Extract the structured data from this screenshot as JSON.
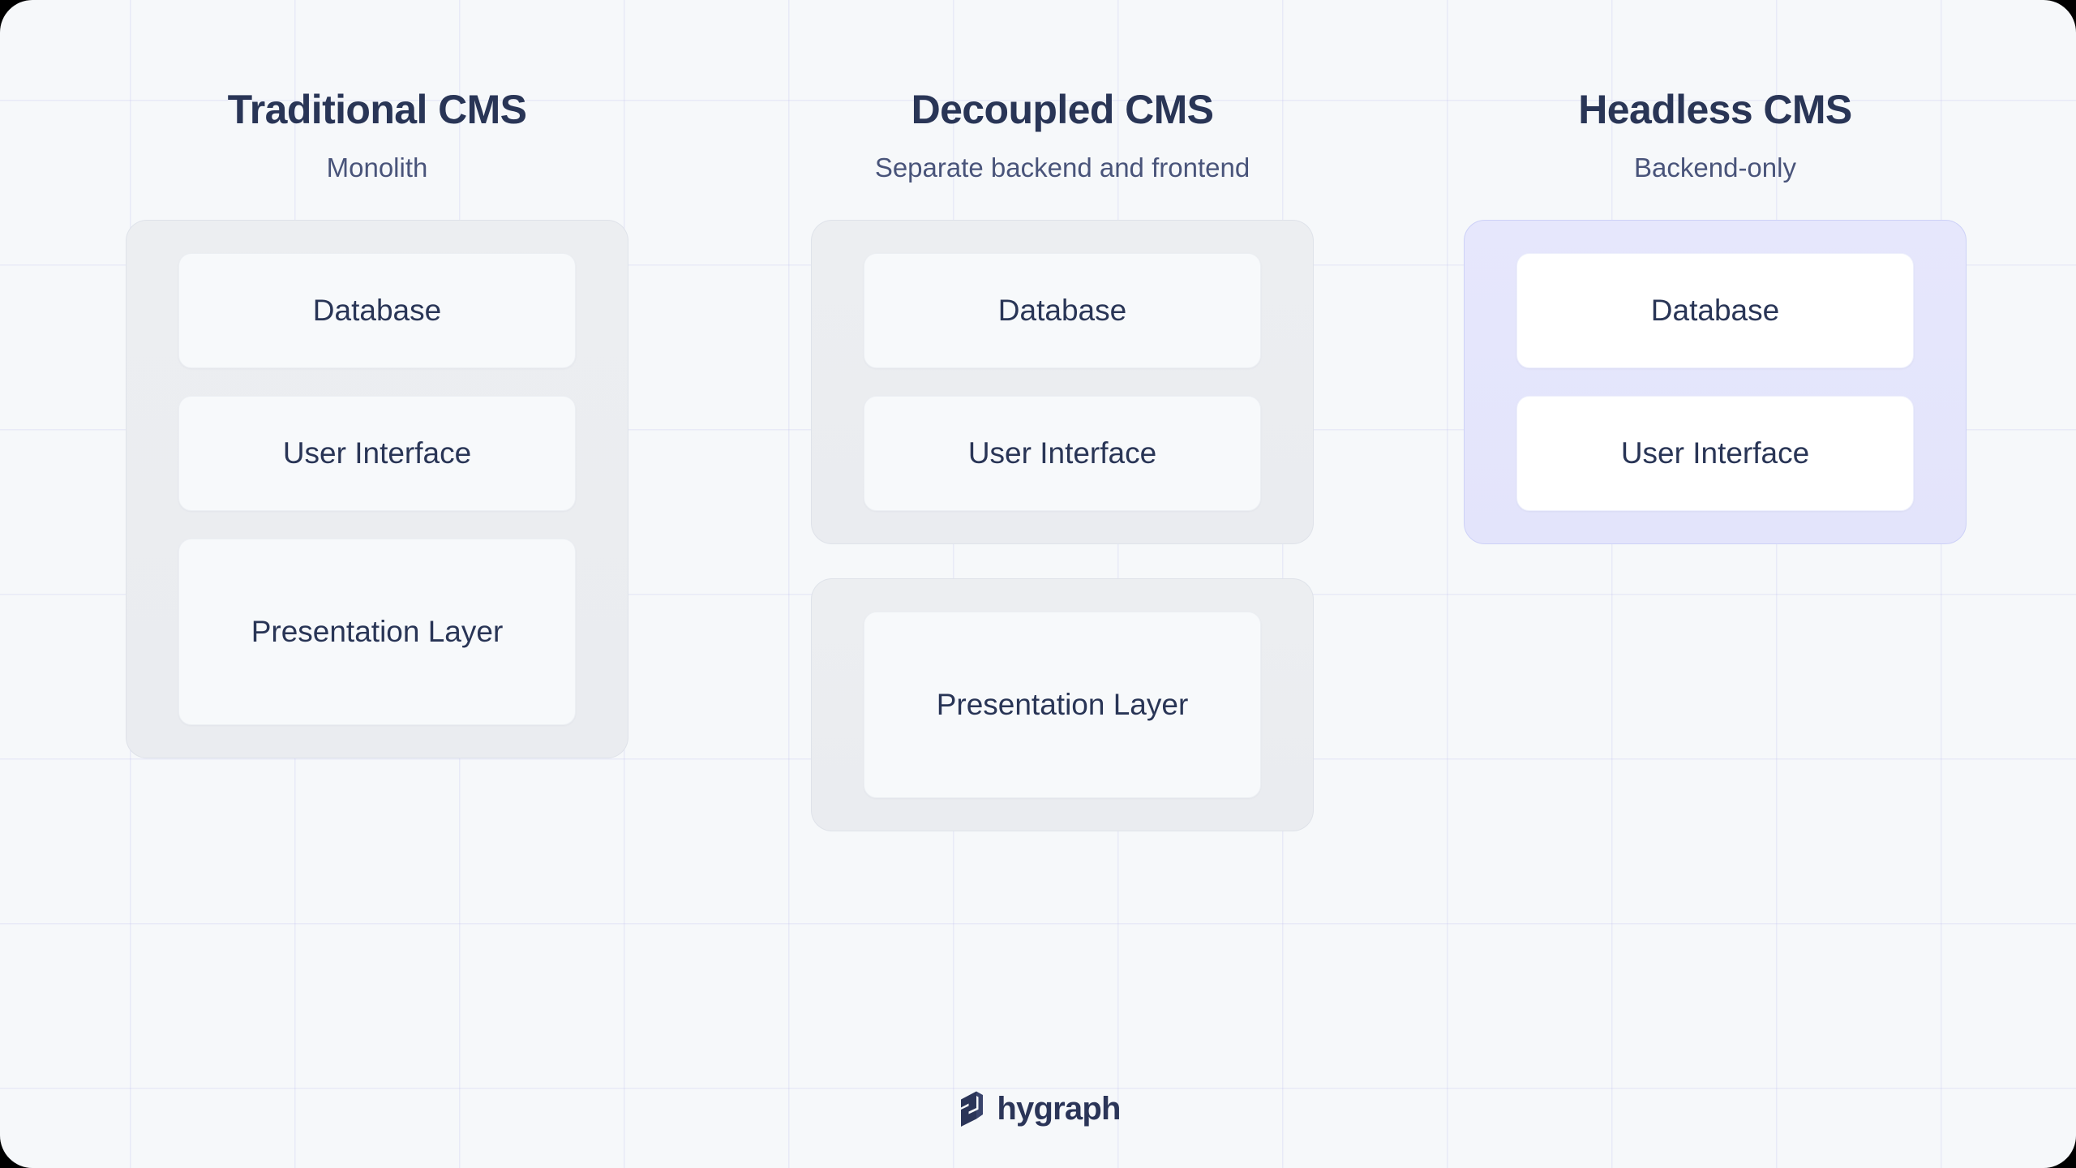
{
  "background": {
    "page_color": "#f6f8fa",
    "grid_color": "#c4c4f0",
    "grid_spacing_px": 203
  },
  "palette": {
    "heading_text": "#293556",
    "subheading_text": "#49547a",
    "card_text": "#293556",
    "plain_container_bg": "#eceef1",
    "plain_card_bg": "#f7f9fb",
    "accent_container_bg": "#e3e4fb",
    "accent_container_border": "#cdd1f7",
    "accent_card_bg": "#ffffff",
    "logo_color": "#2b3558"
  },
  "columns": [
    {
      "id": "traditional-cms",
      "heading": "Traditional CMS",
      "subheading": "Monolith",
      "style": "plain",
      "groups": [
        {
          "style": "plain",
          "cards": [
            {
              "label": "Database",
              "tall": false
            },
            {
              "label": "User Interface",
              "tall": false
            },
            {
              "label": "Presentation Layer",
              "tall": true
            }
          ]
        }
      ]
    },
    {
      "id": "decoupled-cms",
      "heading": "Decoupled CMS",
      "subheading": "Separate backend and frontend",
      "style": "plain",
      "groups": [
        {
          "style": "plain",
          "cards": [
            {
              "label": "Database",
              "tall": false
            },
            {
              "label": "User Interface",
              "tall": false
            }
          ]
        },
        {
          "style": "plain",
          "cards": [
            {
              "label": "Presentation Layer",
              "tall": true
            }
          ]
        }
      ]
    },
    {
      "id": "headless-cms",
      "heading": "Headless CMS",
      "subheading": "Backend-only",
      "style": "accent",
      "groups": [
        {
          "style": "accent",
          "cards": [
            {
              "label": "Database",
              "tall": false
            },
            {
              "label": "User Interface",
              "tall": false
            }
          ]
        }
      ]
    }
  ],
  "footer": {
    "logo_icon": "hygraph-mark-icon",
    "wordmark": "hygraph"
  }
}
